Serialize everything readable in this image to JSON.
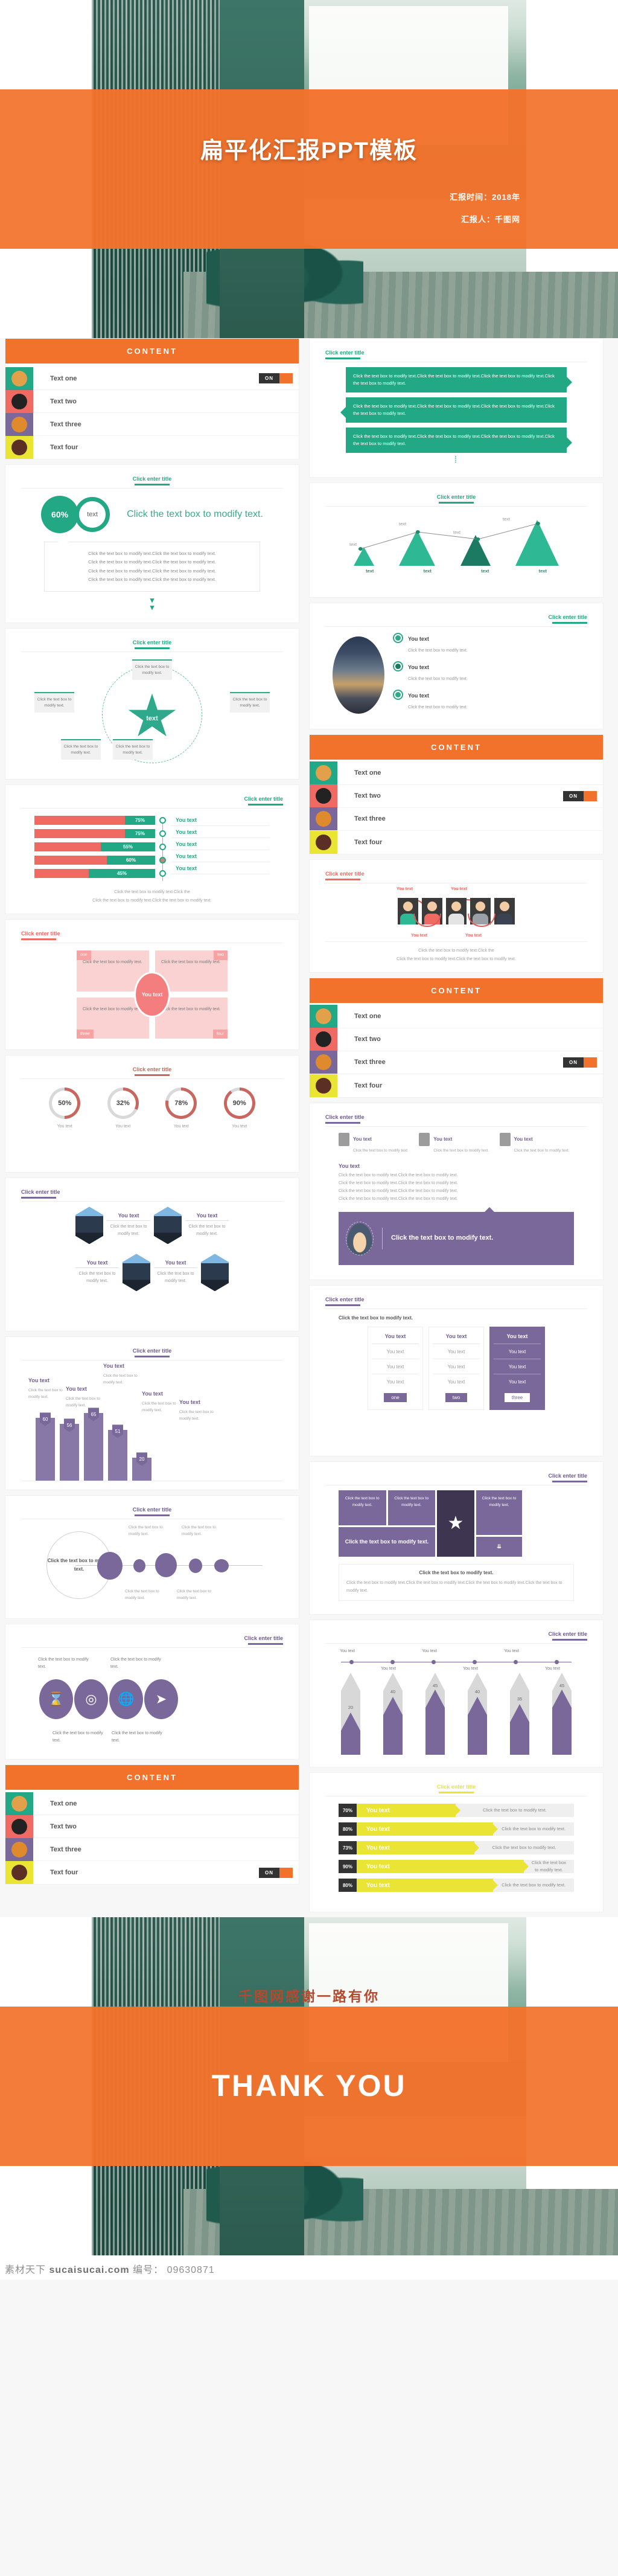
{
  "cover": {
    "title": "扁平化汇报PPT模板",
    "meta_time": "汇报时间：2018年",
    "meta_person": "汇报人：千图网"
  },
  "content_banner": {
    "label": "CONTENT"
  },
  "content_list": {
    "items": [
      {
        "label": "Text one",
        "icon": "coffee-cup-icon",
        "tile_color": "#22a884"
      },
      {
        "label": "Text two",
        "icon": "currency-exchange-icon",
        "tile_color": "#ef6a62"
      },
      {
        "label": "Text three",
        "icon": "at-globe-icon",
        "tile_color": "#7a689b"
      },
      {
        "label": "Text four",
        "icon": "monitor-icon",
        "tile_color": "#eae534"
      }
    ],
    "toggle_label": "ON"
  },
  "section_title": "Click enter title",
  "lorem": {
    "short": "Click the text box to modify text.",
    "bubble": "Click the text box to modify text.Click the text box to modify text.Click the text box to modify text.Click the text box to modify text.",
    "line": "Click the text box to modify text.Click the text box to modify text.",
    "para_top": "Click the text box to modify text.Click the",
    "para_bottom": "Click the text box to modify text.Click the text box to modify text.",
    "two_line": "Click the text box to modify text."
  },
  "pie_slide": {
    "percent": "60%",
    "small_label": "text",
    "headline": "Click the text box to modify text.",
    "body_line": "Click the text box to modify text.Click the text box to modify text.",
    "chevron": "chevron-down-double-icon"
  },
  "you_text": "You text",
  "star_slide": {
    "center_label": "text",
    "boxes": [
      "Click the text box to modify text.",
      "Click the text box to modify text.",
      "Click the text box to modify text.",
      "Click the text box to modify text.",
      "Click the text box to modify text."
    ]
  },
  "photo_bullets": {
    "items": [
      {
        "title": "You text",
        "desc": "Click the text box to modify text."
      },
      {
        "title": "You text",
        "desc": "Click the text box to modify text."
      },
      {
        "title": "You text",
        "desc": "Click the text box to modify text."
      }
    ]
  },
  "quad_slide": {
    "center": "You text",
    "tags": [
      "one",
      "two",
      "three",
      "four"
    ],
    "cells": [
      "Click the text box to modify text.",
      "Click the text box to modify text.",
      "Click the text box to modify text.",
      "Click the text box to modify text."
    ]
  },
  "people_slide": {
    "top_labels": [
      "You text",
      "You text"
    ],
    "bottom_labels": [
      "You text",
      "You text"
    ],
    "body": "Click the text box to modify text.Click the"
  },
  "hex_slide": {
    "items": [
      {
        "title": "You text",
        "desc": "Click the text box to modify text."
      },
      {
        "title": "You text",
        "desc": "Click the text box to modify text."
      },
      {
        "title": "You text",
        "desc": "Click the text box to modify text."
      },
      {
        "title": "You text",
        "desc": "Click the text box to modify text."
      }
    ]
  },
  "trio_slide": {
    "items": [
      {
        "title": "You text",
        "desc": "Click the text box to modify text.",
        "icon": "briefcase-icon"
      },
      {
        "title": "You text",
        "desc": "Click the text box to modify text.",
        "icon": "phone-icon"
      },
      {
        "title": "You text",
        "desc": "Click the text box to modify text.",
        "icon": "laptop-icon"
      }
    ],
    "heading": "You text",
    "body": "Click the text box to modify text.Click the text box to modify text.",
    "banner_text": "Click the text box to modify text.",
    "banner_icon": "handshake-icon"
  },
  "cards_slide": {
    "intro": "Click the text box to modify text.",
    "cards": [
      {
        "header": "You text",
        "rows": [
          "You text",
          "You text",
          "You text"
        ],
        "button": "one"
      },
      {
        "header": "You text",
        "rows": [
          "You text",
          "You text",
          "You text"
        ],
        "button": "two"
      },
      {
        "header": "You text",
        "rows": [
          "You text",
          "You text",
          "You text"
        ],
        "button": "three"
      }
    ]
  },
  "timeline_slide": {
    "hub": "Click the text box to modify text.",
    "labels": [
      "Click the text box to modify text.",
      "Click the text box to modify text.",
      "Click the text box to modify text.",
      "Click the text box to modify text."
    ]
  },
  "collage_slide": {
    "tiles": [
      "Click the text box to modify text.",
      "Click the text box to modify text.",
      "Click the text box to modify text.",
      "Click the text box to modify text."
    ],
    "star_icon": "star-icon",
    "chevron_icon": "chevron-down-double-icon",
    "note_title": "Click the text box to modify text.",
    "note_body": "Click the text box to modify text.Click the text box to modify text.Click the text box to modify text.Click the text box to modify text."
  },
  "picons_slide": {
    "icons": [
      "hourglass-icon",
      "target-icon",
      "globe-icon",
      "paper-plane-icon"
    ],
    "labels": [
      "Click the text box to modify text.",
      "Click the text box to modify text.",
      "Click the text box to modify text.",
      "Click the text box to modify text."
    ]
  },
  "thank_you": {
    "subtitle": "千图网感谢一路有你",
    "title": "THANK YOU"
  },
  "watermark": {
    "brand": "素材天下",
    "site": "sucaisucai.com",
    "id_label": "编号：",
    "id_value": "09630871"
  },
  "chart_data": [
    {
      "type": "bar",
      "title": "Click enter title",
      "categories": [
        "text",
        "text",
        "text",
        "text"
      ],
      "values": [
        38,
        72,
        62,
        92
      ],
      "line_values": [
        30,
        68,
        56,
        96
      ],
      "point_labels": [
        "text",
        "text",
        "text",
        "text"
      ],
      "xlabel": "",
      "ylabel": "",
      "ylim": [
        0,
        100
      ],
      "style": "triangle-bars-with-line",
      "grid": false,
      "legend": "none",
      "colors": [
        "#2eb893",
        "#2eb893",
        "#1d7a62",
        "#2eb893"
      ]
    },
    {
      "type": "bar",
      "title": "Click enter title",
      "orientation": "horizontal",
      "categories": [
        "You text",
        "You text",
        "You text",
        "You text",
        "You text"
      ],
      "values": [
        75,
        75,
        55,
        60,
        45
      ],
      "value_labels": [
        "75%",
        "75%",
        "55%",
        "60%",
        "45%"
      ],
      "xlabel": "",
      "ylabel": "",
      "xlim": [
        0,
        100
      ],
      "grid": false,
      "legend": "none",
      "colors": {
        "fill": "#ef6a62",
        "remainder": "#22a884"
      }
    },
    {
      "type": "pie",
      "title": "Click enter title",
      "categories": [
        "50%",
        "32%",
        "78%",
        "90%"
      ],
      "values": [
        50,
        32,
        78,
        90
      ],
      "labels": [
        "You text",
        "You text",
        "You text",
        "You text"
      ],
      "style": "donut-rings",
      "legend": "below",
      "colors": {
        "arc": "#c8675f",
        "track": "#d9d9d9"
      }
    },
    {
      "type": "bar",
      "title": "Click enter title",
      "categories": [
        "You text",
        "You text",
        "You text",
        "You text",
        "You text"
      ],
      "values": [
        60,
        56,
        65,
        51,
        20
      ],
      "value_labels": [
        "60",
        "56",
        "65",
        "51",
        "20"
      ],
      "annotations": [
        "Click the text box to modify text.",
        "Click the text box to modify text.",
        "Click the text box to modify text.",
        "Click the text box to modify text.",
        "Click the text box to modify text."
      ],
      "xlabel": "",
      "ylabel": "",
      "ylim": [
        0,
        70
      ],
      "grid": false,
      "legend": "none",
      "colors": [
        "#8878a8"
      ]
    },
    {
      "type": "bar",
      "title": "Click enter title",
      "categories": [
        "You text",
        "You text",
        "You text",
        "You text",
        "You text",
        "You text"
      ],
      "values": [
        20,
        40,
        45,
        40,
        35,
        45
      ],
      "value_labels": [
        "20",
        "40",
        "45",
        "40",
        "35",
        "45"
      ],
      "xlabel": "",
      "ylabel": "",
      "ylim": [
        0,
        50
      ],
      "style": "pencil-bars",
      "grid": false,
      "legend": "none",
      "colors": {
        "fill": "#7a689b",
        "track": "#d8d8d8"
      }
    },
    {
      "type": "bar",
      "title": "Click enter title",
      "orientation": "horizontal",
      "categories": [
        "You text",
        "You text",
        "You text",
        "You text",
        "You text"
      ],
      "values": [
        70,
        80,
        73,
        90,
        80
      ],
      "value_labels": [
        "70%",
        "80%",
        "73%",
        "90%",
        "80%"
      ],
      "annotations": [
        "Click the text box to modify text.",
        "Click the text box to modify text.",
        "Click the text box to modify text.",
        "Click the text box to modify text.",
        "Click the text box to modify text."
      ],
      "xlabel": "",
      "ylabel": "",
      "xlim": [
        0,
        100
      ],
      "grid": false,
      "legend": "none",
      "colors": {
        "fill": "#eae534",
        "pct": "#333333",
        "track": "#efefef"
      }
    }
  ]
}
